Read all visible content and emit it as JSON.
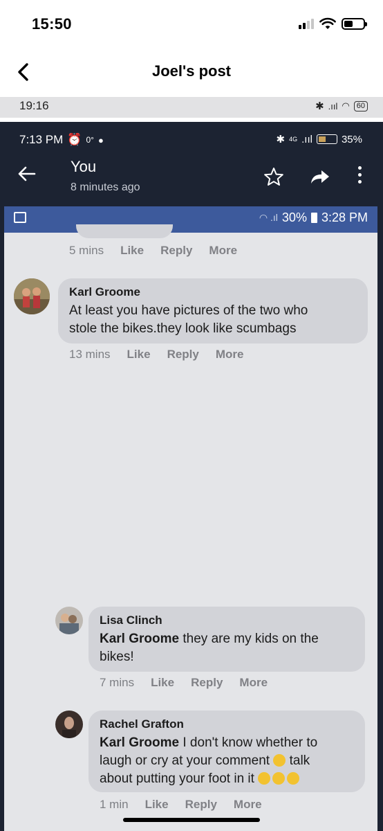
{
  "ios_status": {
    "time": "15:50"
  },
  "nav": {
    "title": "Joel's post"
  },
  "inner_status_1": {
    "time": "19:16",
    "battery": "60"
  },
  "inner_status_2": {
    "time": "7:13 PM",
    "temp": "0°",
    "network": "4G",
    "battery": "35%"
  },
  "post_header": {
    "title": "You",
    "subtitle": "8 minutes ago"
  },
  "inner_status_3": {
    "battery": "30%",
    "time": "3:28 PM"
  },
  "top_actions": {
    "time": "5 mins",
    "like": "Like",
    "reply": "Reply",
    "more": "More"
  },
  "comments": [
    {
      "name": "Karl Groome",
      "text_line1": "At least you have pictures of the two who",
      "text_line2": "stole the bikes.they look like scumbags",
      "time": "13 mins",
      "like": "Like",
      "reply": "Reply",
      "more": "More"
    },
    {
      "name": "Lisa Clinch",
      "mention": "Karl Groome",
      "text_line1": " they are my kids on the",
      "text_line2": "bikes!",
      "time": "7 mins",
      "like": "Like",
      "reply": "Reply",
      "more": "More"
    },
    {
      "name": "Rachel Grafton",
      "mention": "Karl Groome",
      "text_line1": " I don't know whether to",
      "text_line2a": "laugh or cry at your comment ",
      "text_line2b": " talk",
      "text_line3": "about putting your foot in it ",
      "time": "1 min",
      "like": "Like",
      "reply": "Reply",
      "more": "More"
    }
  ],
  "colors": {
    "dark_frame": "#1c2332",
    "blue_strip": "#3d5a9c",
    "bubble": "#d2d3d8",
    "content_bg": "#e4e5e8"
  }
}
